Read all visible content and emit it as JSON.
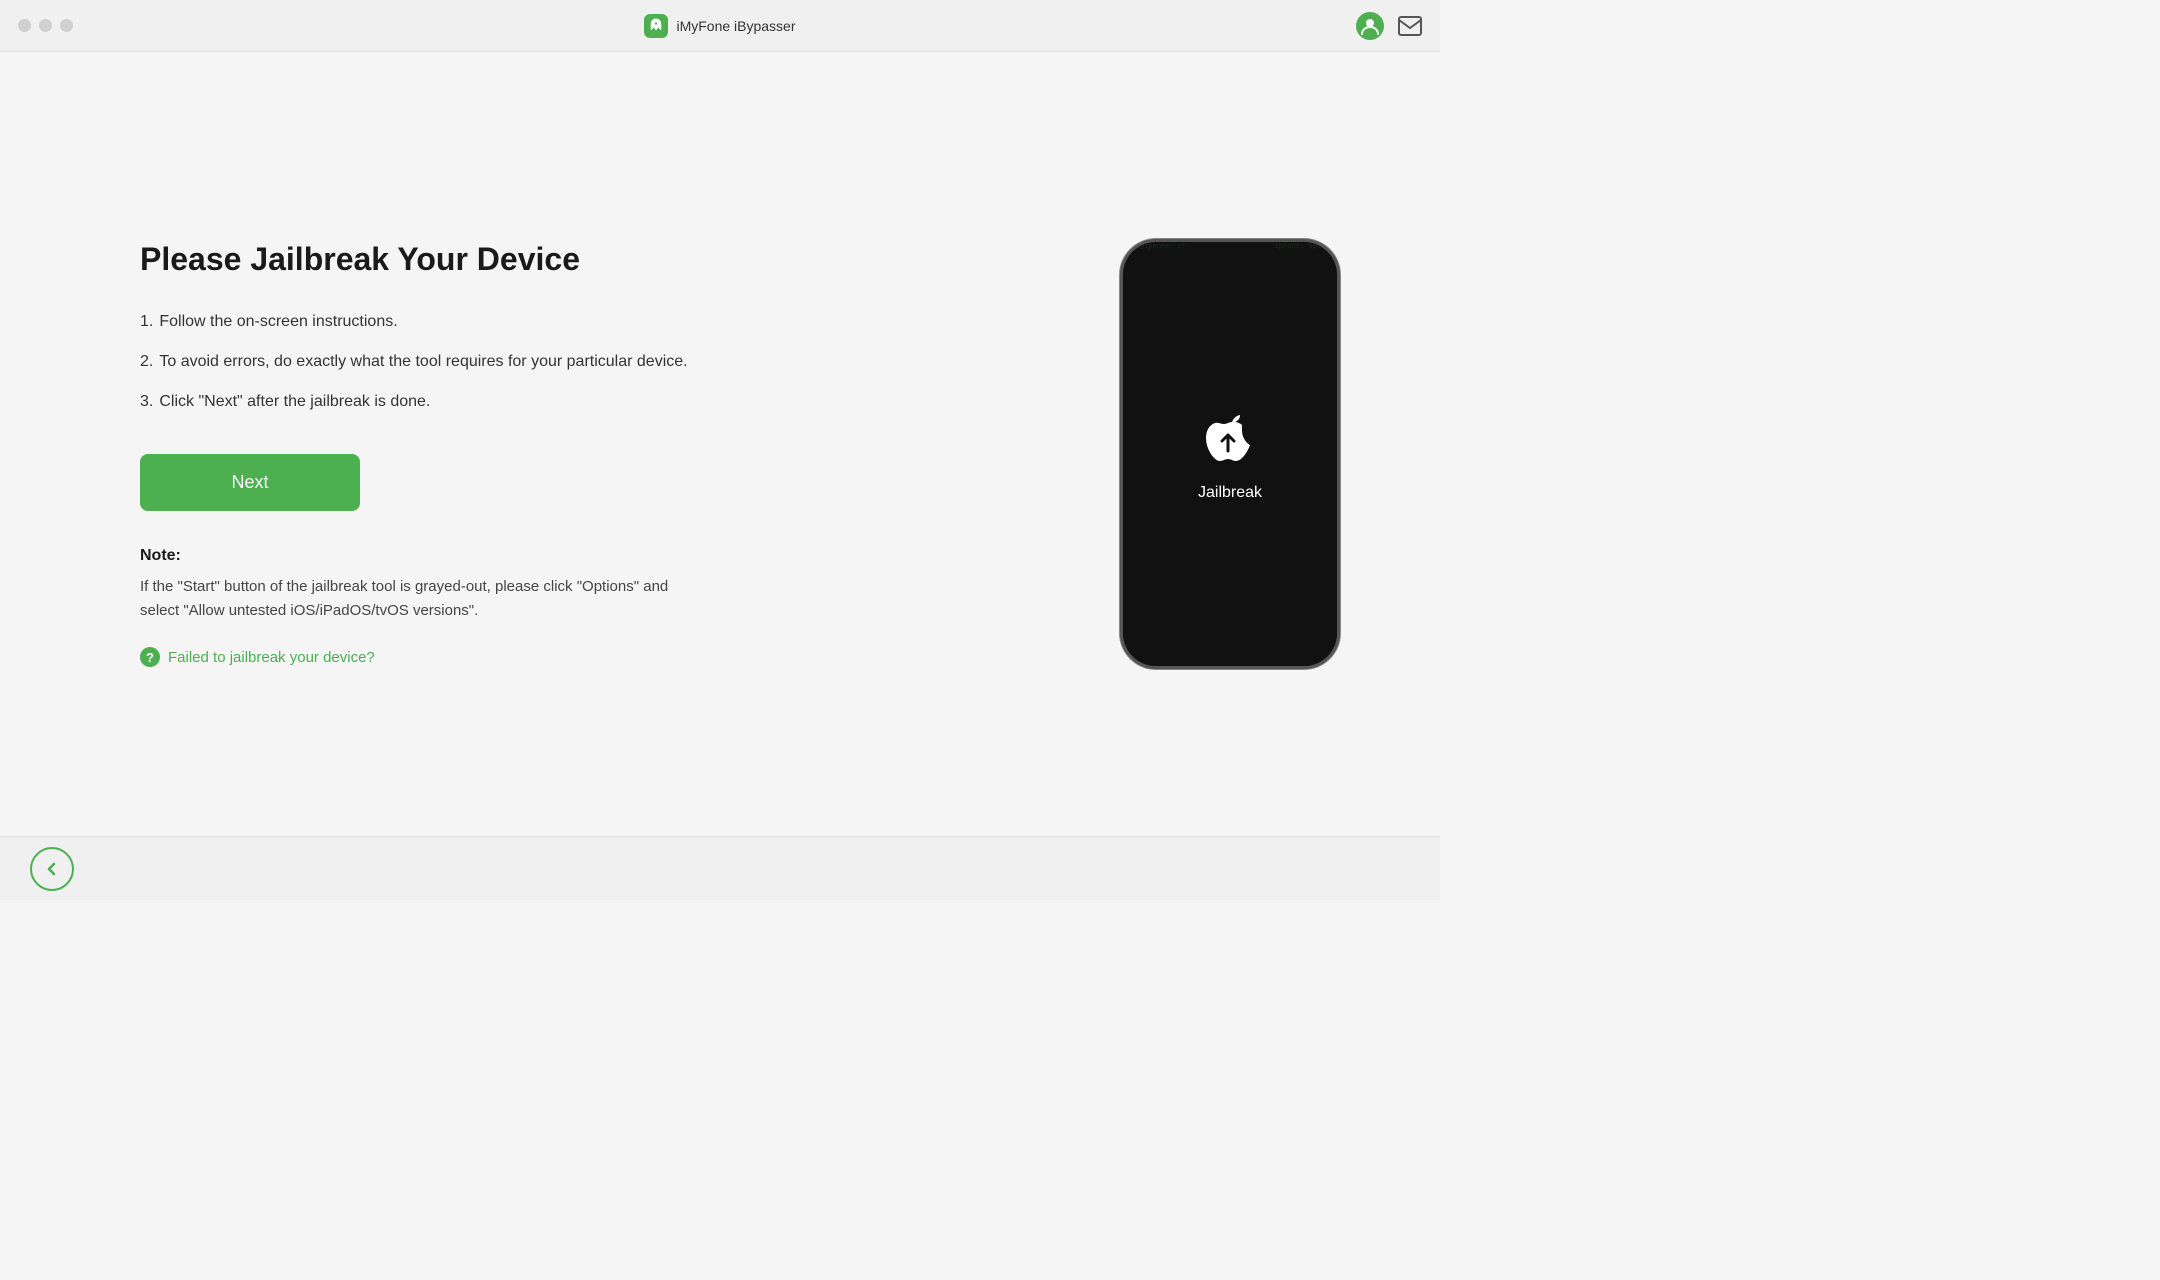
{
  "app": {
    "title": "iMyFone iBypasser",
    "logo_alt": "iMyFone logo"
  },
  "titlebar": {
    "controls": [
      "close",
      "minimize",
      "maximize"
    ]
  },
  "page": {
    "title": "Please Jailbreak Your Device",
    "instructions": [
      {
        "number": "1.",
        "text": "Follow the on-screen instructions."
      },
      {
        "number": "2.",
        "text": "To avoid errors, do exactly what the tool requires for your particular device."
      },
      {
        "number": "3.",
        "text": "Click \"Next\" after the jailbreak is done."
      }
    ],
    "next_button_label": "Next",
    "note_title": "Note:",
    "note_text": "If the \"Start\" button of the jailbreak tool is grayed-out, please click \"Options\" and select \"Allow untested iOS/iPadOS/tvOS versions\".",
    "failed_link_text": "Failed to jailbreak your device?",
    "phone_label": "Jailbreak",
    "phone_bg_code": "root@iphone: chmod 777 /System/Library/CoreServices/SpringBoard.app root@iphone: apt-get install openssh cydia substrate mobilesubstrate root@iphone: killall SpringBoard"
  },
  "back_button": {
    "label": "←"
  }
}
